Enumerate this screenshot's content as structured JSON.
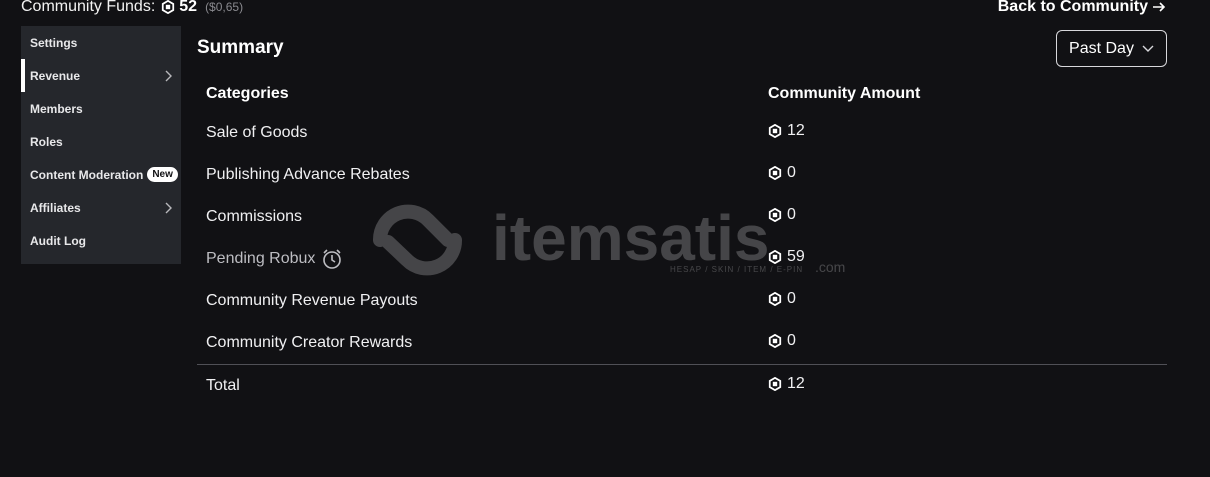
{
  "topbar": {
    "funds_label": "Community Funds:",
    "funds_amount": "52",
    "funds_usd": "($0,65)",
    "back_label": "Back to Community"
  },
  "sidebar": {
    "items": [
      {
        "label": "Settings",
        "active": false,
        "chevron": false
      },
      {
        "label": "Revenue",
        "active": true,
        "chevron": true
      },
      {
        "label": "Members",
        "active": false,
        "chevron": false
      },
      {
        "label": "Roles",
        "active": false,
        "chevron": false
      },
      {
        "label": "Content Moderation",
        "active": false,
        "chevron": false,
        "badge": "New"
      },
      {
        "label": "Affiliates",
        "active": false,
        "chevron": true
      },
      {
        "label": "Audit Log",
        "active": false,
        "chevron": false
      }
    ]
  },
  "summary": {
    "title": "Summary",
    "period": "Past Day",
    "columns": [
      "Categories",
      "Community Amount"
    ],
    "rows": [
      {
        "category": "Sale of Goods",
        "amount": "12"
      },
      {
        "category": "Publishing Advance Rebates",
        "amount": "0"
      },
      {
        "category": "Commissions",
        "amount": "0"
      },
      {
        "category": "Pending Robux",
        "amount": "59"
      },
      {
        "category": "Community Revenue Payouts",
        "amount": "0"
      },
      {
        "category": "Community Creator Rewards",
        "amount": "0"
      }
    ],
    "total": {
      "label": "Total",
      "amount": "12"
    }
  },
  "watermark": {
    "brand": "itemsatis",
    "sub": "HESAP / SKIN / ITEM / E-PIN",
    "tld": ".com"
  },
  "icons": {
    "robux": "robux-icon",
    "clock": "clock-icon",
    "chevron_right": "chevron-right-icon",
    "arrow_right": "arrow-right-icon",
    "chevron_down": "chevron-down-icon"
  }
}
